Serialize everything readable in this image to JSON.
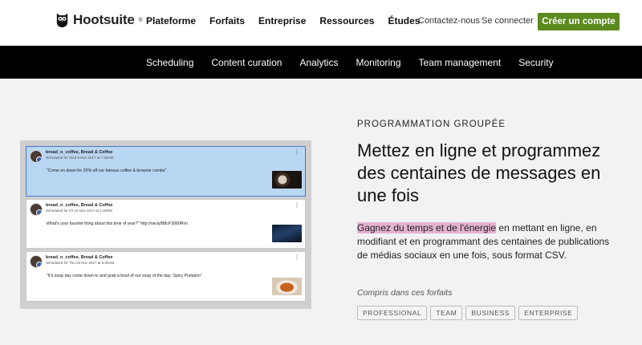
{
  "header": {
    "logo_text": "Hootsuite",
    "logo_icon": "owl-icon",
    "nav": [
      "Plateforme",
      "Forfaits",
      "Entreprise",
      "Ressources",
      "Études"
    ],
    "contact": "Contactez-nous",
    "login": "Se connecter",
    "cta": "Créer un compte",
    "cta_color": "#5b8a1e"
  },
  "subnav": [
    "Scheduling",
    "Content curation",
    "Analytics",
    "Monitoring",
    "Team management",
    "Security"
  ],
  "mockup": {
    "cards": [
      {
        "name": "bread_n_coffee, Bread & Coffee",
        "scheduled": "Scheduled for Wed 8 Nov 2017 at 7:25AM",
        "text": "\"Come on down for 20% off our famous coffee & brownie combo\"",
        "thumbnail": "coffee-brownie-photo"
      },
      {
        "name": "bread_n_coffee, Bread & Coffee",
        "scheduled": "Scheduled for Fri 10 Nov 2017 at 1:30PM",
        "text": "What's your favorite thing about this time of year?\" http://ow.ly/B8cF3060Rvn",
        "thumbnail": "night-sky-photo"
      },
      {
        "name": "bread_n_coffee, Bread & Coffee",
        "scheduled": "Scheduled for Thu 23 Nov 2017 at 6:05AM",
        "text": "\"It's soup day come down to and grab a bowl of our soup of the day: Spicy Pumpkin\"",
        "thumbnail": "soup-bowl-photo"
      }
    ]
  },
  "content": {
    "eyebrow": "PROGRAMMATION GROUPÉE",
    "headline": "Mettez en ligne et programmez des centaines de messages en une fois",
    "body_highlight": "Gagnez du temps et de l'énergie",
    "body_rest": " en mettant en ligne, en modifiant et en programmant des centaines de publications de médias sociaux en une fois, sous format CSV.",
    "included_label": "Compris dans ces forfaits",
    "plans": [
      "PROFESSIONAL",
      "TEAM",
      "BUSINESS",
      "ENTERPRISE"
    ]
  }
}
